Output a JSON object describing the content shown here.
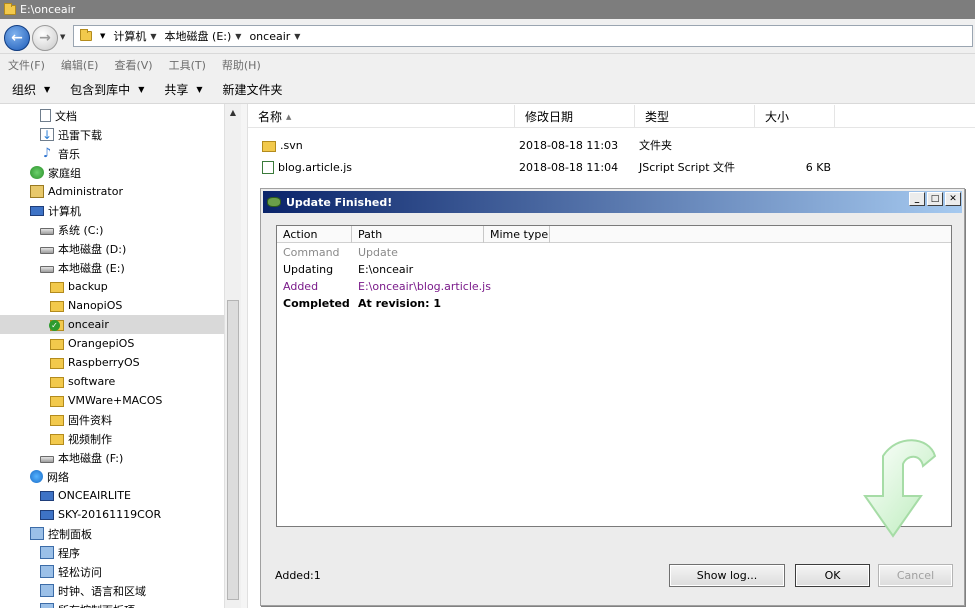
{
  "window": {
    "title": "E:\\onceair"
  },
  "address": {
    "crumbs": [
      "计算机",
      "本地磁盘 (E:)",
      "onceair"
    ]
  },
  "menu": [
    "文件(F)",
    "编辑(E)",
    "查看(V)",
    "工具(T)",
    "帮助(H)"
  ],
  "toolbar": {
    "organize": "组织",
    "include": "包含到库中",
    "share": "共享",
    "new_folder": "新建文件夹"
  },
  "tree": [
    {
      "label": "文档",
      "icon": "document-icon",
      "indent": 1
    },
    {
      "label": "迅雷下载",
      "icon": "download-icon",
      "indent": 1
    },
    {
      "label": "音乐",
      "icon": "music-icon",
      "indent": 1
    },
    {
      "label": "家庭组",
      "icon": "homegroup-icon",
      "indent": 0
    },
    {
      "label": "Administrator",
      "icon": "user-folder-icon",
      "indent": 0
    },
    {
      "label": "计算机",
      "icon": "computer-icon",
      "indent": 0
    },
    {
      "label": "系统 (C:)",
      "icon": "drive-icon",
      "indent": 1
    },
    {
      "label": "本地磁盘 (D:)",
      "icon": "drive-icon",
      "indent": 1
    },
    {
      "label": "本地磁盘 (E:)",
      "icon": "drive-icon",
      "indent": 1
    },
    {
      "label": "backup",
      "icon": "folder-icon",
      "indent": 2
    },
    {
      "label": "NanopiOS",
      "icon": "folder-icon",
      "indent": 2
    },
    {
      "label": "onceair",
      "icon": "svn-folder-icon",
      "indent": 2,
      "selected": true
    },
    {
      "label": "OrangepiOS",
      "icon": "folder-icon",
      "indent": 2
    },
    {
      "label": "RaspberryOS",
      "icon": "folder-icon",
      "indent": 2
    },
    {
      "label": "software",
      "icon": "folder-icon",
      "indent": 2
    },
    {
      "label": "VMWare+MACOS",
      "icon": "folder-icon",
      "indent": 2
    },
    {
      "label": "固件资料",
      "icon": "folder-icon",
      "indent": 2
    },
    {
      "label": "视频制作",
      "icon": "folder-icon",
      "indent": 2
    },
    {
      "label": "本地磁盘 (F:)",
      "icon": "drive-icon",
      "indent": 1
    },
    {
      "label": "网络",
      "icon": "network-icon",
      "indent": 0
    },
    {
      "label": "ONCEAIRLITE",
      "icon": "computer-icon",
      "indent": 1
    },
    {
      "label": "SKY-20161119COR",
      "icon": "computer-icon",
      "indent": 1
    },
    {
      "label": "控制面板",
      "icon": "control-panel-icon",
      "indent": 0
    },
    {
      "label": "程序",
      "icon": "control-panel-icon",
      "indent": 1
    },
    {
      "label": "轻松访问",
      "icon": "control-panel-icon",
      "indent": 1
    },
    {
      "label": "时钟、语言和区域",
      "icon": "control-panel-icon",
      "indent": 1
    },
    {
      "label": "所有控制面板项",
      "icon": "control-panel-icon",
      "indent": 1
    }
  ],
  "filelist": {
    "columns": [
      "名称",
      "修改日期",
      "类型",
      "大小"
    ],
    "rows": [
      {
        "name": ".svn",
        "date": "2018-08-18 11:03",
        "type": "文件夹",
        "size": "",
        "icon": "folder-icon"
      },
      {
        "name": "blog.article.js",
        "date": "2018-08-18 11:04",
        "type": "JScript Script 文件",
        "size": "6 KB",
        "icon": "js-file-icon"
      }
    ]
  },
  "dialog": {
    "title": "Update Finished!",
    "columns": [
      "Action",
      "Path",
      "Mime type"
    ],
    "rows": [
      {
        "action": "Command",
        "path": "Update",
        "style": "gray"
      },
      {
        "action": "Updating",
        "path": "E:\\onceair",
        "style": "normal"
      },
      {
        "action": "Added",
        "path": "E:\\onceair\\blog.article.js",
        "style": "purple"
      },
      {
        "action": "Completed",
        "path": "At revision: 1",
        "style": "bold"
      }
    ],
    "status": "Added:1",
    "buttons": {
      "showlog": "Show log...",
      "ok": "OK",
      "cancel": "Cancel"
    }
  }
}
